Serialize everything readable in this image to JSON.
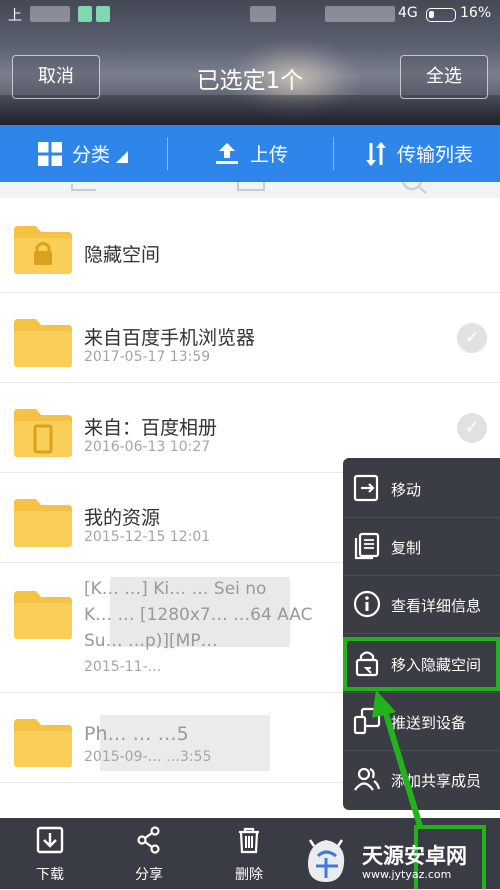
{
  "status": {
    "left_char": "上",
    "network": "4G",
    "battery": "16%"
  },
  "header": {
    "cancel": "取消",
    "title": "已选定1个",
    "select_all": "全选"
  },
  "toolbar": {
    "category": "分类",
    "upload": "上传",
    "transfer": "传输列表"
  },
  "files": [
    {
      "name": "隐藏空间",
      "date": "",
      "selected": false,
      "type": "locked"
    },
    {
      "name": "来自百度手机浏览器",
      "date": "2017-05-17  13:59",
      "selected": false,
      "type": "folder"
    },
    {
      "name": "来自：百度相册",
      "date": "2016-06-13  10:27",
      "selected": false,
      "type": "phone"
    },
    {
      "name": "我的资源",
      "date": "2015-12-15  12:01",
      "selected": true,
      "type": "folder"
    },
    {
      "name_line1": "[K…  …] Ki…  …  Sei no",
      "name_line2": "K…  …  [1280x7…  …64 AAC",
      "name_line3": "Su…  …p)][MP…",
      "date": "2015-11-…",
      "type": "folder"
    },
    {
      "name": "Ph…  …  …5",
      "date": "2015-09-…  …3:55",
      "type": "folder"
    }
  ],
  "menu": {
    "items": [
      {
        "label": "移动",
        "icon": "move-icon"
      },
      {
        "label": "复制",
        "icon": "copy-icon"
      },
      {
        "label": "查看详细信息",
        "icon": "info-icon"
      },
      {
        "label": "移入隐藏空间",
        "icon": "lock-move-icon"
      },
      {
        "label": "推送到设备",
        "icon": "device-icon"
      },
      {
        "label": "添加共享成员",
        "icon": "people-icon"
      }
    ],
    "highlight_color": "#22b21c"
  },
  "bottom": {
    "download": "下载",
    "share": "分享",
    "delete": "删除"
  },
  "watermark": {
    "text": "天源安卓网",
    "url": "www.jytyaz.com"
  },
  "colors": {
    "primary": "#2f86ea",
    "folder": "#f6c243",
    "menu_bg": "#3b3d44",
    "highlight": "#22b21c"
  }
}
